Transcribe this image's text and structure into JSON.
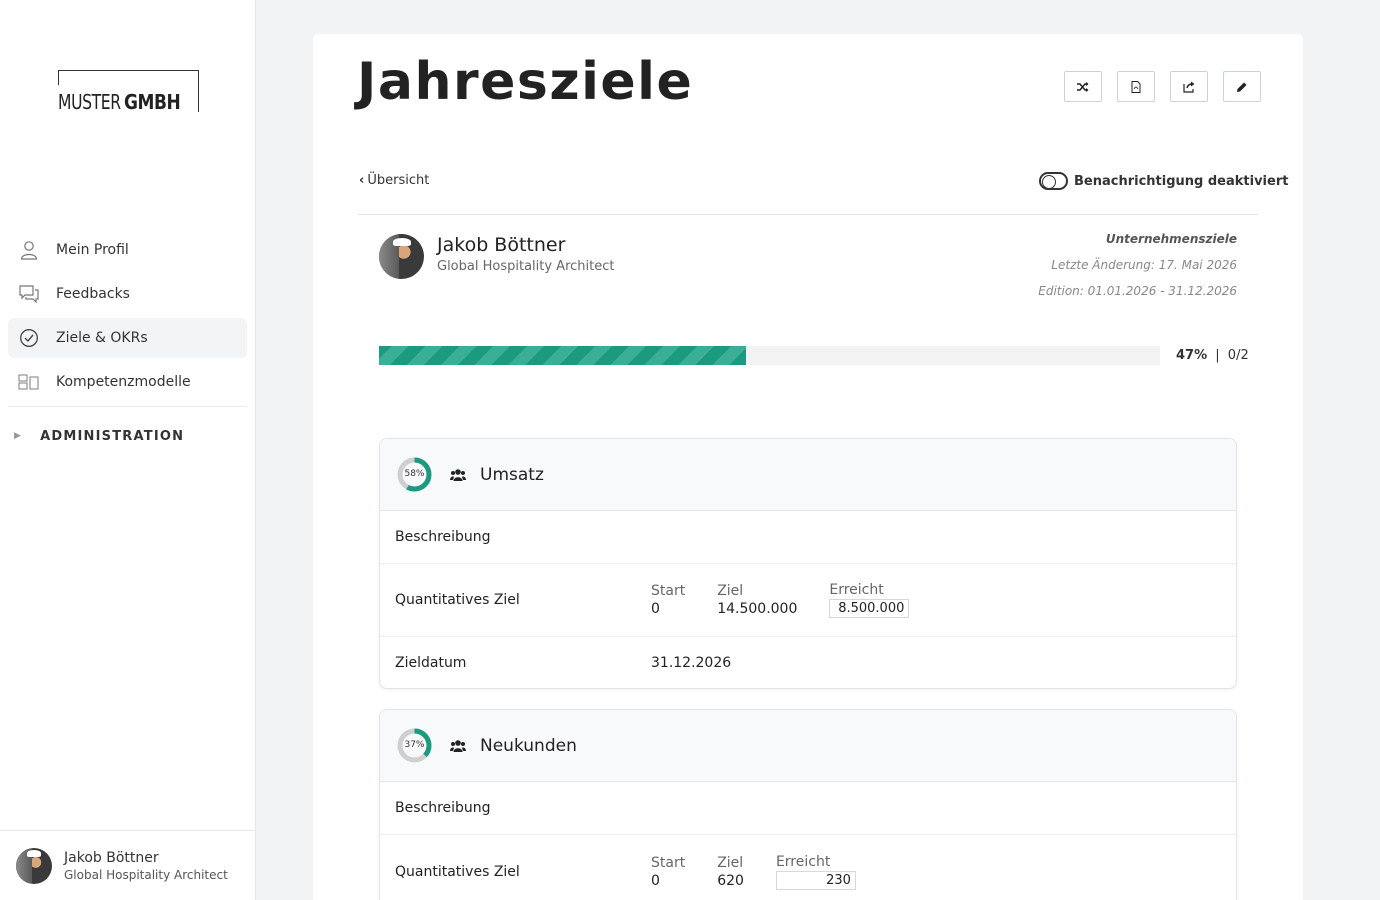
{
  "app": {
    "logo_text_light": "MUSTER",
    "logo_text_bold": "GMBH"
  },
  "sidebar": {
    "items": [
      {
        "label": "Mein Profil",
        "icon": "user-icon"
      },
      {
        "label": "Feedbacks",
        "icon": "chat-icon"
      },
      {
        "label": "Ziele & OKRs",
        "icon": "check-circle-icon",
        "active": true
      },
      {
        "label": "Kompetenzmodelle",
        "icon": "blocks-icon"
      }
    ],
    "admin_label": "ADMINISTRATION",
    "footer": {
      "name": "Jakob Böttner",
      "role": "Global Hospitality Architect"
    }
  },
  "page": {
    "title": "Jahresziele",
    "toolbar_icons": [
      "shuffle-icon",
      "pdf-icon",
      "share-icon",
      "edit-icon"
    ],
    "back_label": "Übersicht",
    "notification_label": "Benachrichtigung deaktiviert",
    "notification_enabled": false
  },
  "person": {
    "name": "Jakob Böttner",
    "role": "Global Hospitality Architect"
  },
  "meta": {
    "type": "Unternehmensziele",
    "last_change": "Letzte Änderung: 17. Mai 2026",
    "edition": "Edition: 01.01.2026 - 31.12.2026"
  },
  "progress": {
    "percent": 47,
    "percent_label": "47%",
    "separator": "|",
    "count_label": "0/2"
  },
  "goals": [
    {
      "percent": 58,
      "percent_label": "58%",
      "title": "Umsatz",
      "description_label": "Beschreibung",
      "quant_label": "Quantitatives Ziel",
      "start_header": "Start",
      "start_value": "0",
      "target_header": "Ziel",
      "target_value": "14.500.000",
      "achieved_header": "Erreicht",
      "achieved_value": "8.500.000",
      "date_label": "Zieldatum",
      "date_value": "31.12.2026"
    },
    {
      "percent": 37,
      "percent_label": "37%",
      "title": "Neukunden",
      "description_label": "Beschreibung",
      "quant_label": "Quantitatives Ziel",
      "start_header": "Start",
      "start_value": "0",
      "target_header": "Ziel",
      "target_value": "620",
      "achieved_header": "Erreicht",
      "achieved_value": "230"
    }
  ],
  "colors": {
    "accent": "#1b9a80",
    "donut_track": "#cfcfcf"
  }
}
